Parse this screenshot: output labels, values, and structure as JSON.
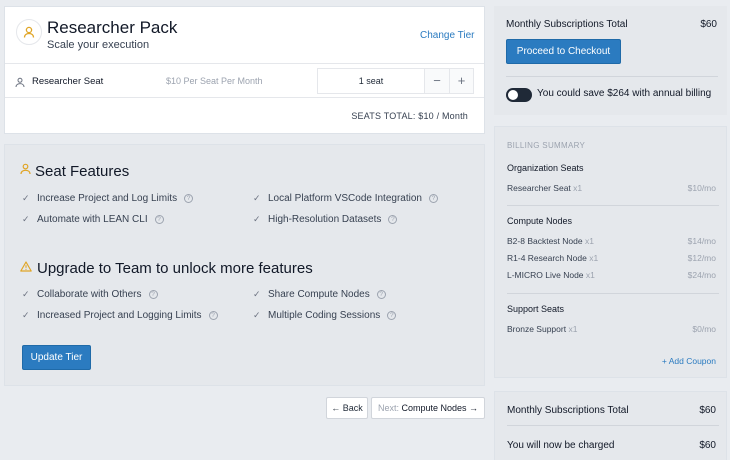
{
  "pack": {
    "title": "Researcher Pack",
    "subtitle": "Scale your execution",
    "change_tier": "Change Tier",
    "seat_name": "Researcher Seat",
    "seat_price": "$10 Per Seat Per Month",
    "seat_value": "1 seat",
    "minus": "−",
    "plus": "+",
    "seats_total": "SEATS TOTAL: $10 / Month"
  },
  "features": {
    "title": "Seat Features",
    "left": [
      "Increase Project and Log Limits",
      "Automate with LEAN CLI"
    ],
    "right": [
      "Local Platform VSCode Integration",
      "High-Resolution Datasets"
    ]
  },
  "upgrade": {
    "title": "Upgrade to Team to unlock more features",
    "left": [
      "Collaborate with Others",
      "Increased Project and Logging Limits"
    ],
    "right": [
      "Share Compute Nodes",
      "Multiple Coding Sessions"
    ],
    "button": "Update Tier"
  },
  "nav": {
    "back": "← Back",
    "next_prefix": "Next:",
    "next_label": "Compute Nodes →"
  },
  "summary_top": {
    "label": "Monthly Subscriptions Total",
    "value": "$60",
    "checkout": "Proceed to Checkout",
    "annual_text": "You could save $264 with annual billing"
  },
  "billing": {
    "header": "BILLING SUMMARY",
    "groups": [
      {
        "name": "Organization Seats",
        "items": [
          {
            "name": "Researcher Seat",
            "mult": "x1",
            "price": "$10/mo"
          }
        ]
      },
      {
        "name": "Compute Nodes",
        "items": [
          {
            "name": "B2-8 Backtest Node",
            "mult": "x1",
            "price": "$14/mo"
          },
          {
            "name": "R1-4 Research Node",
            "mult": "x1",
            "price": "$12/mo"
          },
          {
            "name": "L-MICRO Live Node",
            "mult": "x1",
            "price": "$24/mo"
          }
        ]
      },
      {
        "name": "Support Seats",
        "items": [
          {
            "name": "Bronze Support",
            "mult": "x1",
            "price": "$0/mo"
          }
        ]
      }
    ],
    "coupon": "+ Add Coupon"
  },
  "summary_bottom": {
    "label": "Monthly Subscriptions Total",
    "value": "$60",
    "charged_label": "You will now be charged",
    "charged_value": "$60"
  },
  "colors": {
    "accent": "#2b7bc0",
    "warning": "#e0a526"
  }
}
